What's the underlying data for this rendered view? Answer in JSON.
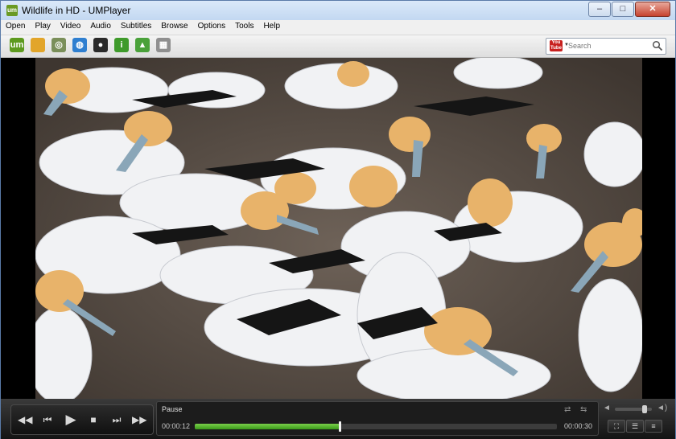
{
  "window": {
    "title": "Wildlife in HD - UMPlayer",
    "app_icon_text": "um",
    "minimize": "–",
    "maximize": "□",
    "close": "✕"
  },
  "menubar": {
    "items": [
      {
        "label": "Open"
      },
      {
        "label": "Play"
      },
      {
        "label": "Video"
      },
      {
        "label": "Audio"
      },
      {
        "label": "Subtitles"
      },
      {
        "label": "Browse"
      },
      {
        "label": "Options"
      },
      {
        "label": "Tools"
      },
      {
        "label": "Help"
      }
    ]
  },
  "toolbar": {
    "icons": [
      {
        "name": "umplayer-logo-icon",
        "glyph": "um",
        "color": "#5d9a1f"
      },
      {
        "name": "open-folder-icon",
        "glyph": "",
        "color": "#e2a52a"
      },
      {
        "name": "disc-icon",
        "glyph": "◎",
        "color": "#7a8f5a"
      },
      {
        "name": "globe-icon",
        "glyph": "◍",
        "color": "#2f7fd0"
      },
      {
        "name": "tv-icon",
        "glyph": "●",
        "color": "#2a2a2a"
      },
      {
        "name": "info-icon",
        "glyph": "i",
        "color": "#3e9a2a"
      },
      {
        "name": "shoutcast-icon",
        "glyph": "▲",
        "color": "#4aa13a"
      },
      {
        "name": "screenshot-icon",
        "glyph": "▦",
        "color": "#8f8f8f"
      }
    ],
    "search": {
      "placeholder": "Search",
      "service_top": "You",
      "service_bottom": "Tube"
    }
  },
  "controls": {
    "status": "Pause",
    "time_current": "00:00:12",
    "time_total": "00:00:30",
    "progress": 0.4,
    "volume": 0.8,
    "buttons": {
      "rewind": "◀◀",
      "previous": "⏮",
      "play": "▶",
      "stop": "■",
      "next": "⏭",
      "forward": "▶▶"
    },
    "right_buttons": [
      "⛶",
      "☰",
      "≡"
    ],
    "volume_low_glyph": "◄",
    "volume_high_glyph": "◄)",
    "repeat_glyph": "⇄",
    "shuffle_glyph": "⇆"
  },
  "colors": {
    "accent": "#5fb832",
    "seek_track": "#3c3c3c",
    "video_bg": "#000000",
    "control_bg": "#1c1c1c"
  }
}
